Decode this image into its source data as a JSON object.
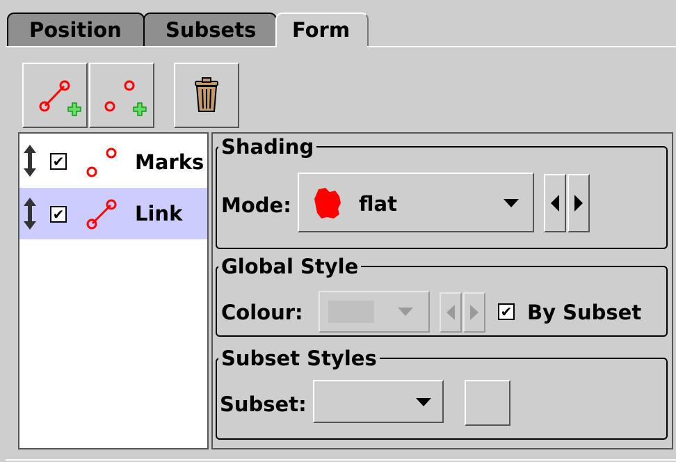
{
  "tabs": [
    {
      "label": "Position",
      "selected": false
    },
    {
      "label": "Subsets",
      "selected": false
    },
    {
      "label": "Form",
      "selected": true
    }
  ],
  "toolbar": {
    "buttons": [
      {
        "icon": "add-link-layer-icon"
      },
      {
        "icon": "add-marks-layer-icon"
      },
      {
        "icon": "trash-icon"
      }
    ]
  },
  "layers": [
    {
      "label": "Marks",
      "checked": true,
      "checkmark": "✔",
      "icon": "marks-icon",
      "selected": false
    },
    {
      "label": "Link",
      "checked": true,
      "checkmark": "✔",
      "icon": "link-icon",
      "selected": true
    }
  ],
  "shading": {
    "title": "Shading",
    "mode_label": "Mode:",
    "mode_value": "flat",
    "mode_icon": "flat-shading-icon"
  },
  "global_style": {
    "title": "Global Style",
    "colour_label": "Colour:",
    "colour_enabled": false,
    "by_subset_label": "By Subset",
    "by_subset_checked": true,
    "checkmark": "✔"
  },
  "subset_styles": {
    "title": "Subset Styles",
    "subset_label": "Subset:",
    "subset_value": ""
  },
  "colors": {
    "marker_red": "#ff0000",
    "plus_green": "#33cc33",
    "selection_bg": "#ccccff",
    "panel_bg": "#cecece"
  }
}
